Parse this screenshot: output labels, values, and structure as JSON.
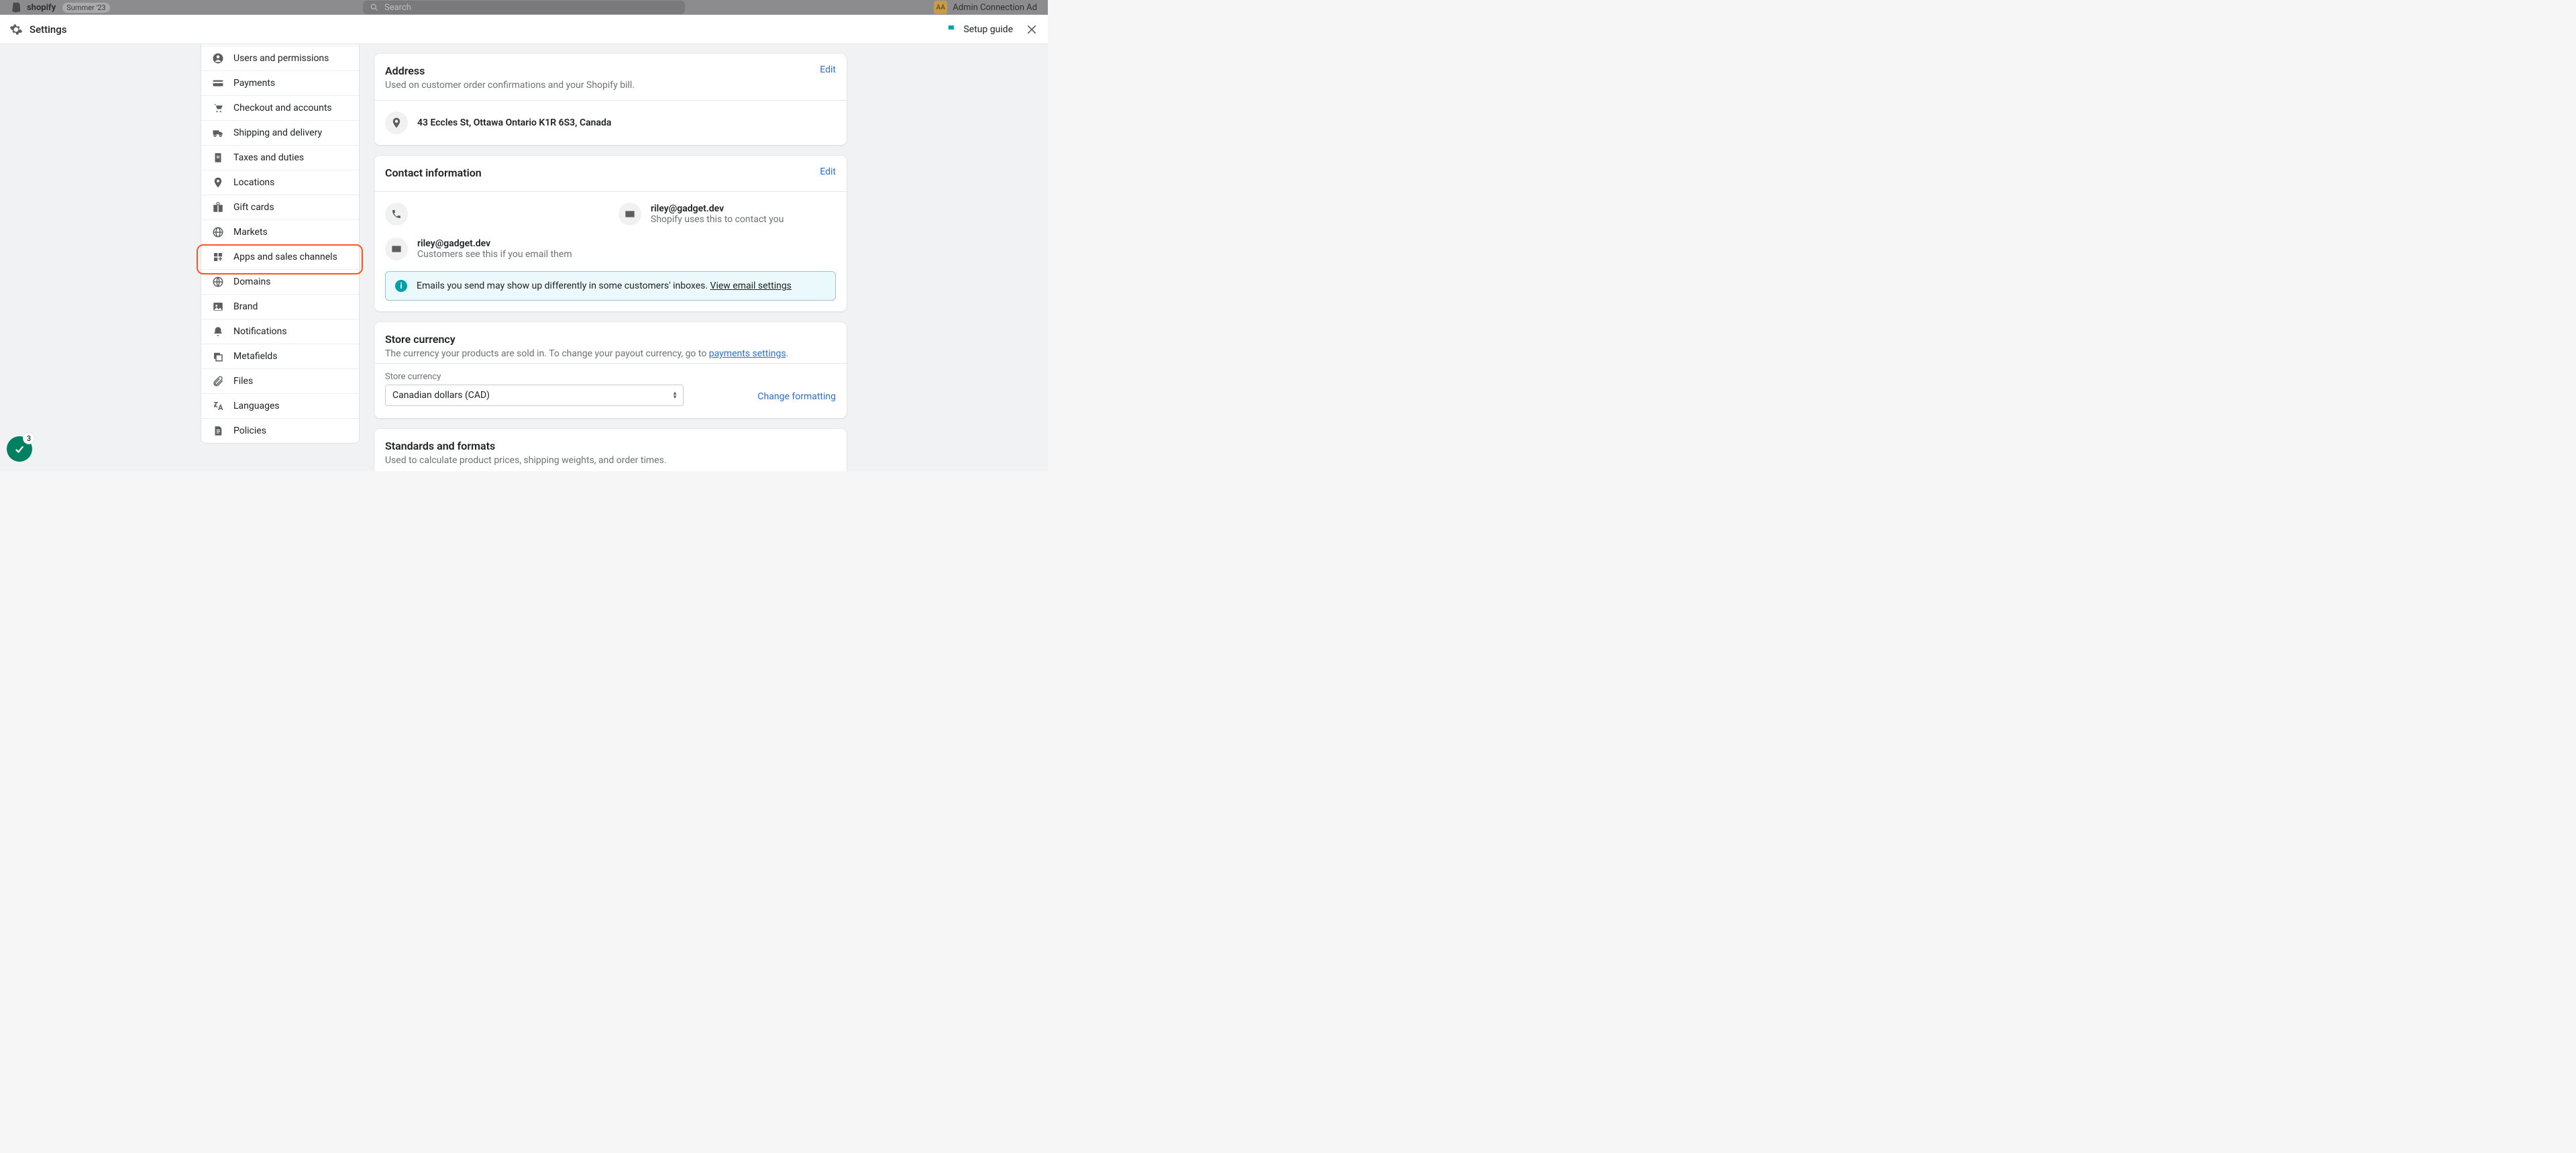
{
  "bg_topbar": {
    "brand": "shopify",
    "tag": "Summer '23",
    "search_placeholder": "Search",
    "avatar_initials": "AA",
    "user_label": "Admin Connection Ad"
  },
  "header": {
    "title": "Settings",
    "setup_guide": "Setup guide"
  },
  "sidebar": {
    "items": [
      {
        "label": "Users and permissions",
        "icon": "user-circle"
      },
      {
        "label": "Payments",
        "icon": "credit-card"
      },
      {
        "label": "Checkout and accounts",
        "icon": "cart"
      },
      {
        "label": "Shipping and delivery",
        "icon": "truck"
      },
      {
        "label": "Taxes and duties",
        "icon": "receipt"
      },
      {
        "label": "Locations",
        "icon": "location"
      },
      {
        "label": "Gift cards",
        "icon": "gift"
      },
      {
        "label": "Markets",
        "icon": "globe"
      },
      {
        "label": "Apps and sales channels",
        "icon": "apps"
      },
      {
        "label": "Domains",
        "icon": "domain"
      },
      {
        "label": "Brand",
        "icon": "image"
      },
      {
        "label": "Notifications",
        "icon": "bell"
      },
      {
        "label": "Metafields",
        "icon": "layers"
      },
      {
        "label": "Files",
        "icon": "attachment"
      },
      {
        "label": "Languages",
        "icon": "translate"
      },
      {
        "label": "Policies",
        "icon": "document"
      }
    ],
    "highlighted_index": 8
  },
  "address_card": {
    "title": "Address",
    "subtitle": "Used on customer order confirmations and your Shopify bill.",
    "edit": "Edit",
    "value": "43 Eccles St, Ottawa Ontario K1R 6S3, Canada"
  },
  "contact_card": {
    "title": "Contact information",
    "edit": "Edit",
    "phone": {
      "value": "",
      "note": ""
    },
    "sender_email": {
      "value": "riley@gadget.dev",
      "note": "Customers see this if you email them"
    },
    "account_email": {
      "value": "riley@gadget.dev",
      "note": "Shopify uses this to contact you"
    },
    "banner_prefix": "Emails you send may show up differently in some customers' inboxes. ",
    "banner_link": "View email settings"
  },
  "currency_card": {
    "title": "Store currency",
    "subtitle_prefix": "The currency your products are sold in. To change your payout currency, go to ",
    "subtitle_link": "payments settings",
    "subtitle_suffix": ".",
    "field_label": "Store currency",
    "selected": "Canadian dollars (CAD)",
    "change_link": "Change formatting"
  },
  "standards_card": {
    "title": "Standards and formats",
    "subtitle": "Used to calculate product prices, shipping weights, and order times."
  },
  "fab": {
    "badge": "3"
  }
}
